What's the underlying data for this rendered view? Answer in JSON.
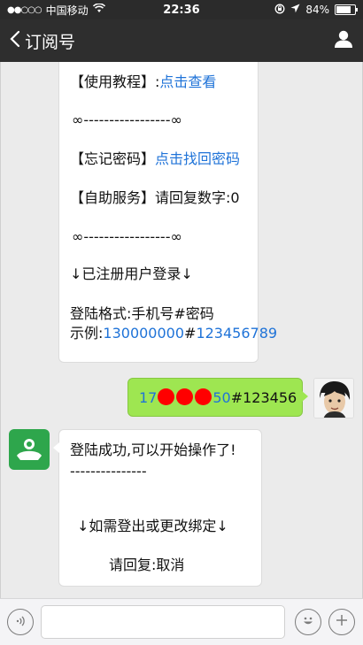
{
  "status_bar": {
    "signal_dots": "●●○○○",
    "carrier": "中国移动",
    "time": "22:36",
    "battery": "84%"
  },
  "nav": {
    "back_label": "订阅号"
  },
  "bot_message_1": {
    "line_tutorial_label": "【使用教程】:",
    "line_tutorial_link": "点击查看",
    "divider_1": "∞-----------------∞",
    "line_forgot_label": "【忘记密码】",
    "line_forgot_link": "点击找回密码",
    "line_self_service": "【自助服务】请回复数字:0",
    "divider_2": "∞-----------------∞",
    "registered_login": "↓已注册用户登录↓",
    "login_format": "登陆格式:手机号#密码",
    "example_label": "示例:",
    "example_phone": "130000000",
    "example_hash": "#",
    "example_password": "123456789"
  },
  "user_message": {
    "prefix": "17",
    "suffix": "50",
    "rest": "#123456"
  },
  "bot_message_2": {
    "line_success": "登陆成功,可以开始操作了!",
    "line_dashes": "---------------",
    "line_unbind": "↓如需登出或更改绑定↓",
    "line_reply_cancel": "请回复:取消"
  },
  "colors": {
    "link": "#1f73d8",
    "outgoing_bubble": "#9ee651",
    "redaction": "#ff0000",
    "bot_avatar": "#2ea64c"
  },
  "icons": {
    "nav_back": "chevron-left-icon",
    "nav_profile": "person-icon",
    "voice": "voice-icon",
    "emoji": "emoji-icon",
    "plus": "plus-icon"
  }
}
